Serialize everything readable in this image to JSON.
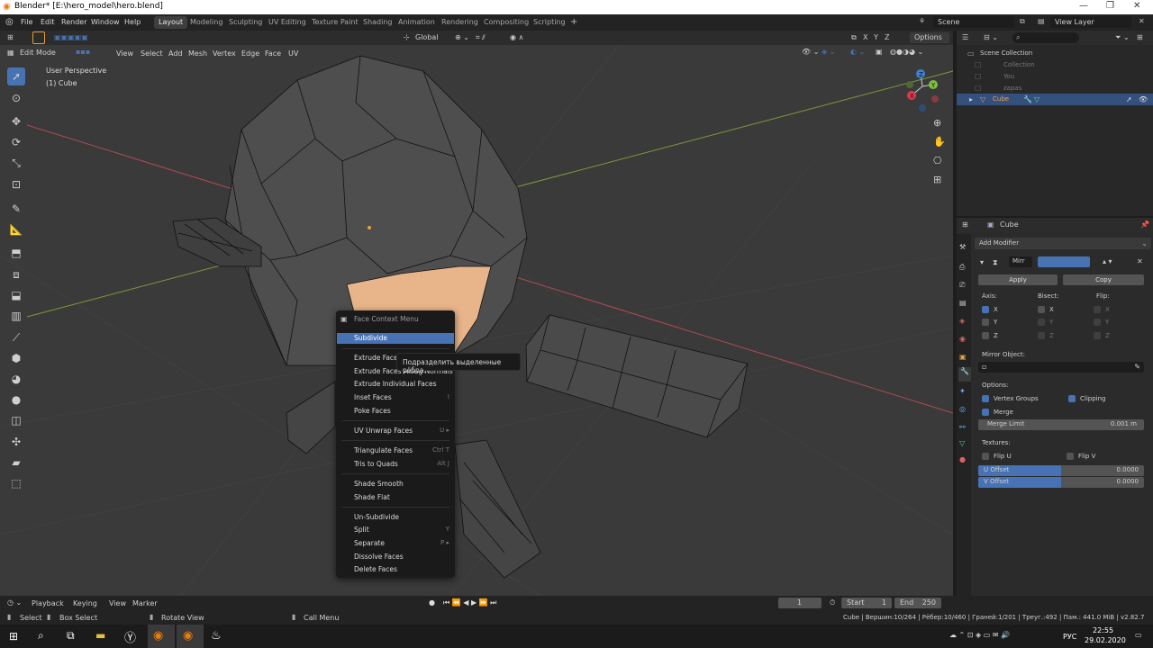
{
  "window": {
    "title": "Blender* [E:\\hero_model\\hero.blend]"
  },
  "menu": {
    "file": "File",
    "edit": "Edit",
    "render": "Render",
    "window": "Window",
    "help": "Help"
  },
  "workspaces": [
    "Layout",
    "Modeling",
    "Sculpting",
    "UV Editing",
    "Texture Paint",
    "Shading",
    "Animation",
    "Rendering",
    "Compositing",
    "Scripting"
  ],
  "scene": {
    "scene_label": "Scene",
    "view_layer": "View Layer"
  },
  "viewport": {
    "transform_orientation": "Global",
    "options": "Options",
    "mode": "Edit Mode",
    "menus": [
      "View",
      "Select",
      "Add",
      "Mesh",
      "Vertex",
      "Edge",
      "Face",
      "UV"
    ],
    "perspective": "User Perspective",
    "object": "(1) Cube",
    "gizmo_x": "X",
    "gizmo_y": "Y",
    "gizmo_z": "Z",
    "axis_lock": [
      "X",
      "Y",
      "Z"
    ]
  },
  "context_menu": {
    "title": "Face Context Menu",
    "items": [
      {
        "label": "Subdivide",
        "shortcut": ""
      },
      {
        "label": "Extrude Faces",
        "shortcut": ""
      },
      {
        "label": "Extrude Faces Along Normals",
        "shortcut": ""
      },
      {
        "label": "Extrude Individual Faces",
        "shortcut": ""
      },
      {
        "label": "Inset Faces",
        "shortcut": "I"
      },
      {
        "label": "Poke Faces",
        "shortcut": ""
      },
      {
        "label": "UV Unwrap Faces",
        "shortcut": "U ▸"
      },
      {
        "label": "Triangulate Faces",
        "shortcut": "Ctrl T"
      },
      {
        "label": "Tris to Quads",
        "shortcut": "Alt J"
      },
      {
        "label": "Shade Smooth",
        "shortcut": ""
      },
      {
        "label": "Shade Flat",
        "shortcut": ""
      },
      {
        "label": "Un-Subdivide",
        "shortcut": ""
      },
      {
        "label": "Split",
        "shortcut": "Y"
      },
      {
        "label": "Separate",
        "shortcut": "P ▸"
      },
      {
        "label": "Dissolve Faces",
        "shortcut": ""
      },
      {
        "label": "Delete Faces",
        "shortcut": ""
      }
    ],
    "tooltip": "Подразделить выделенные рёбра."
  },
  "outliner": {
    "root": "Scene Collection",
    "items": [
      "Collection",
      "You",
      "zapas",
      "Cube"
    ]
  },
  "properties": {
    "object_name": "Cube",
    "add_modifier": "Add Modifier",
    "modifier_name": "Mirr",
    "apply": "Apply",
    "copy": "Copy",
    "axis": "Axis:",
    "bisect": "Bisect:",
    "flip": "Flip:",
    "x": "X",
    "y": "Y",
    "z": "Z",
    "mirror_object": "Mirror Object:",
    "options": "Options:",
    "vertex_groups": "Vertex Groups",
    "clipping": "Clipping",
    "merge": "Merge",
    "merge_limit": "Merge Limit",
    "merge_limit_value": "0.001 m",
    "textures": "Textures:",
    "flip_u": "Flip U",
    "flip_v": "Flip V",
    "u_offset": "U Offset",
    "u_offset_value": "0.0000",
    "v_offset": "V Offset",
    "v_offset_value": "0.0000"
  },
  "timeline": {
    "playback": "Playback",
    "keying": "Keying",
    "view": "View",
    "marker": "Marker",
    "current_frame": "1",
    "start_label": "Start",
    "start": "1",
    "end_label": "End",
    "end": "250"
  },
  "statusbar": {
    "select": "Select",
    "box_select": "Box Select",
    "rotate_view": "Rotate View",
    "call_menu": "Call Menu",
    "stats": "Cube | Вершин:10/264 | Рёбер:10/460 | Граней:1/201 | Треуг.:492 | Пам.: 441.0 MiB | v2.82.7"
  },
  "taskbar": {
    "lang": "РУС",
    "time": "22:55",
    "date": "29.02.2020"
  },
  "colors": {
    "accent": "#4772b3",
    "selected_face": "#e8b48a",
    "viewport_bg": "#3a3a3a"
  }
}
